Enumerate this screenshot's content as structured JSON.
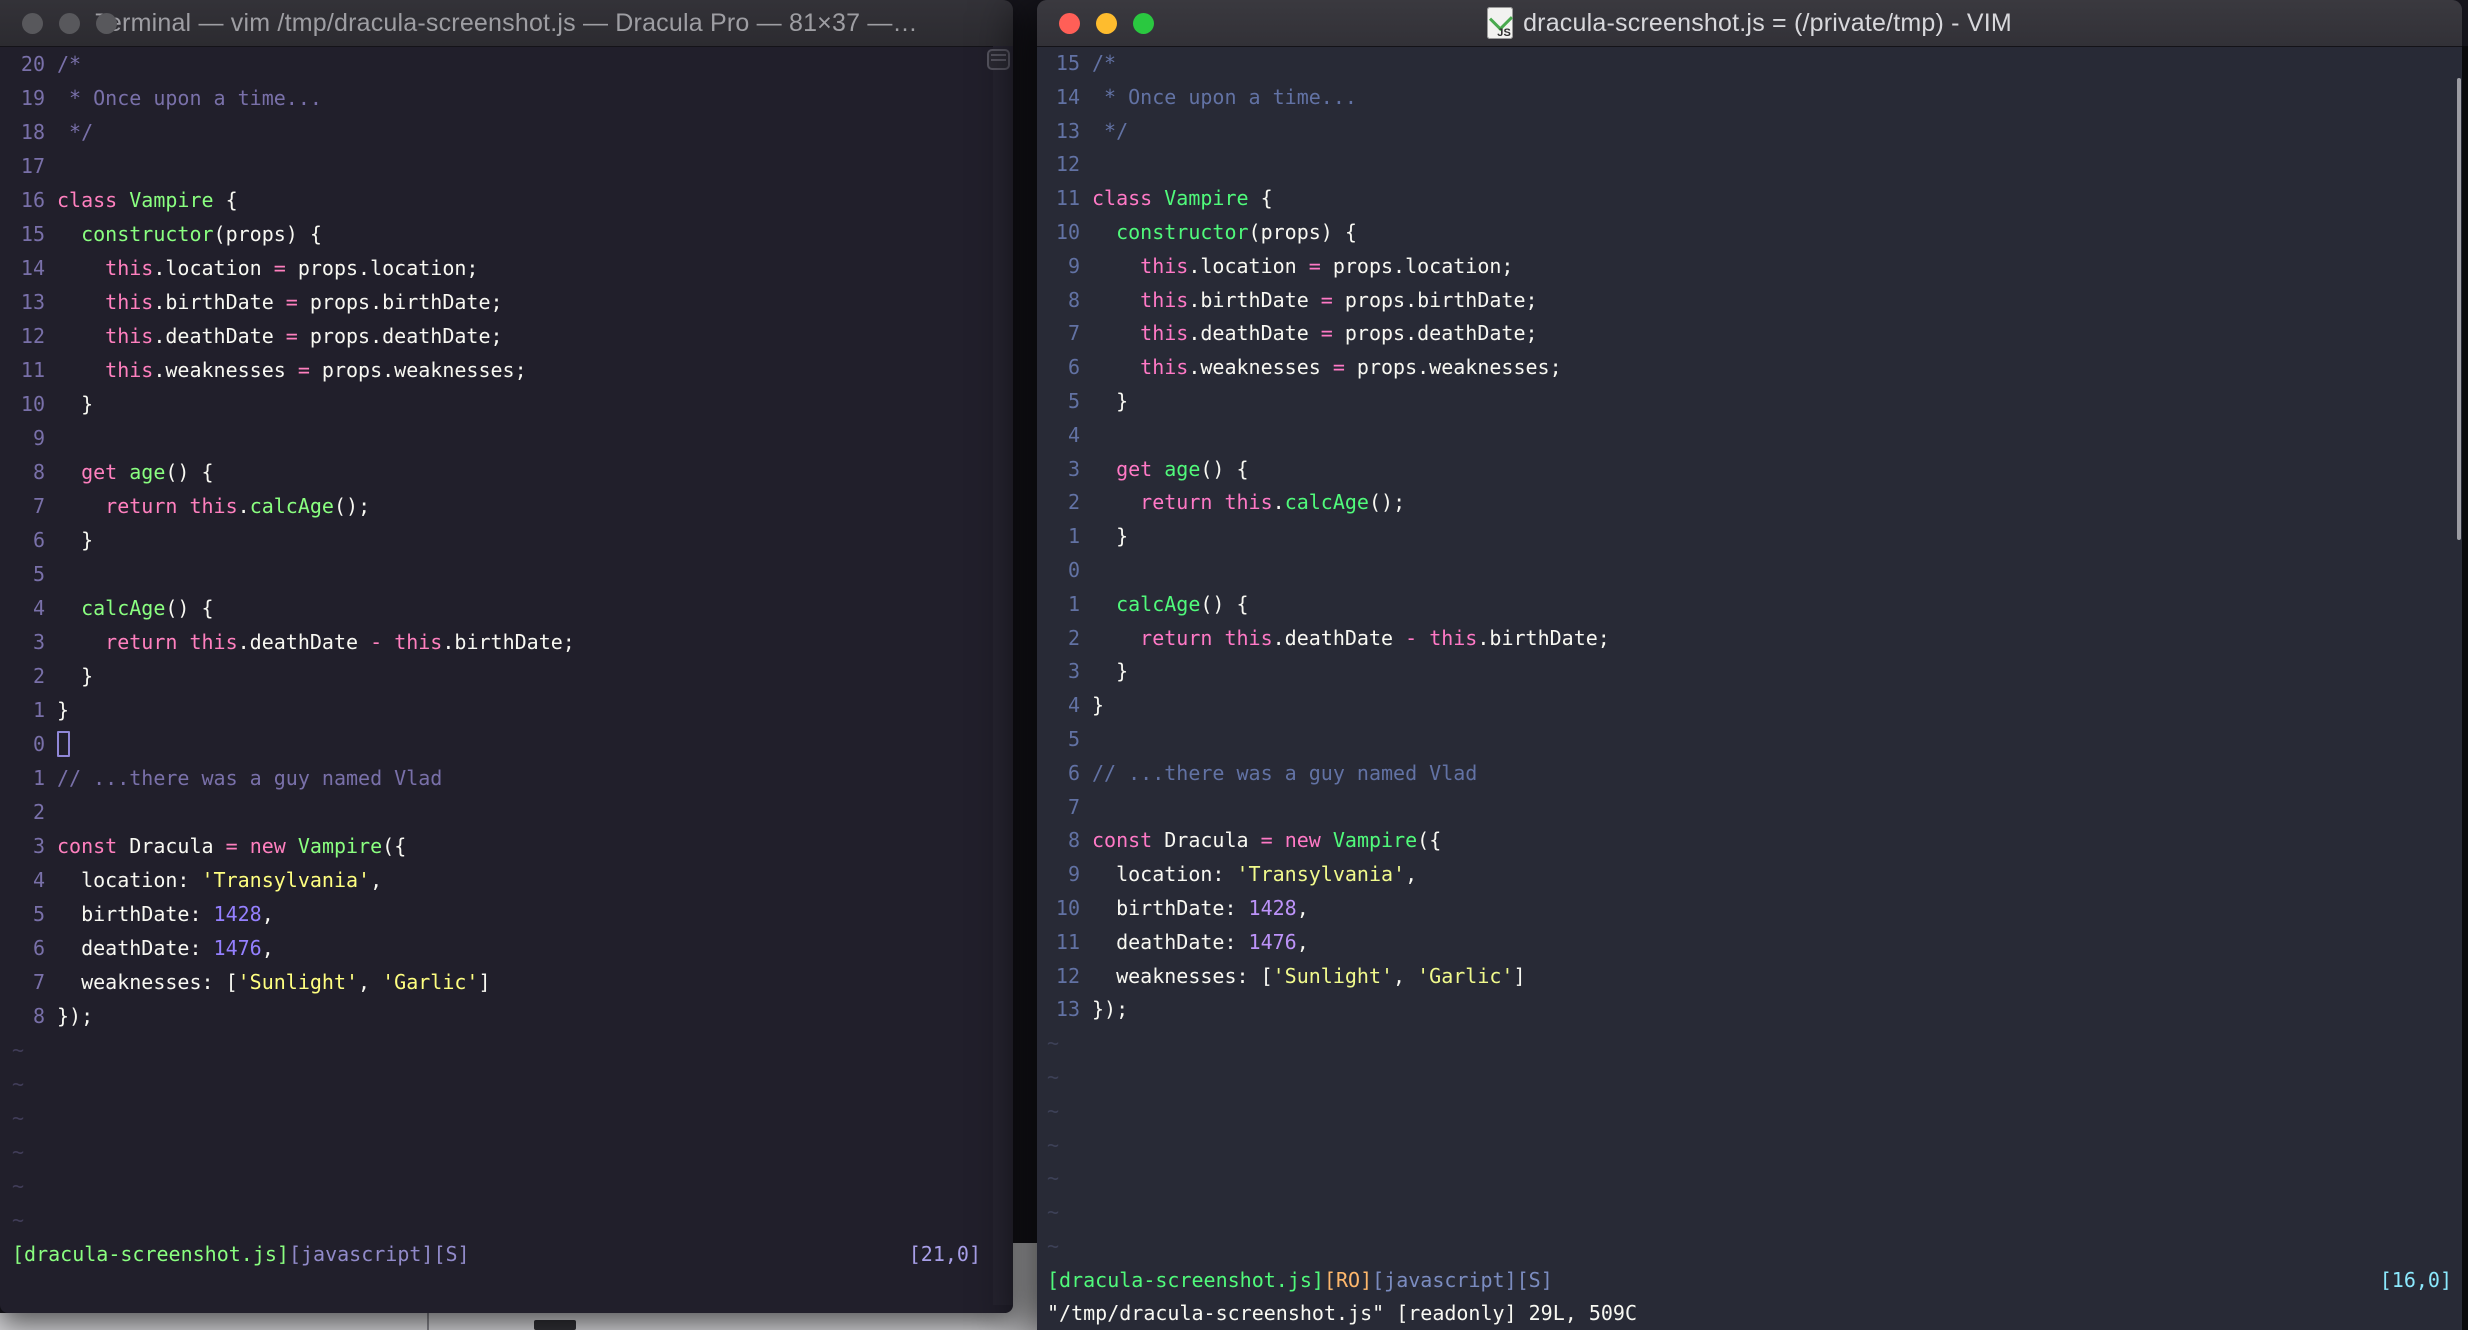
{
  "colors": {
    "desktop_strip": "#D1D1D4",
    "left_bg": "#211F2B",
    "right_bg": "#282A36",
    "left_titlebar": "#333238",
    "right_titlebar": "#3A393F",
    "left_title_text": "#9E9EA3",
    "right_title_text": "#D8D8DC",
    "light_inactive": "#58585C",
    "light_red": "#FF5F57",
    "light_yellow": "#FEBC2E",
    "light_green": "#2AC840"
  },
  "palettes": {
    "left": {
      "f": "#F8F8F2",
      "c": "#7970A9",
      "p": "#FF80BF",
      "g": "#8AFF80",
      "u": "#9580FF",
      "y": "#FFFF80",
      "o": "#FFCA80",
      "s": "#918AC9",
      "loc": "#A89FE8",
      "ln": "#7970A9",
      "tilde": "#413D59",
      "cursor": "#9087D8"
    },
    "right": {
      "f": "#F8F8F2",
      "c": "#6272A4",
      "p": "#FF79C6",
      "g": "#50FA7B",
      "u": "#BD93F9",
      "y": "#F1FA8C",
      "o": "#FFB86C",
      "s": "#7B8CC0",
      "loc": "#8BE9FD",
      "ln": "#6272A4",
      "tilde": "#3D4157",
      "cursor": "#F8F8F2"
    }
  },
  "left_window": {
    "title": "Terminal — vim /tmp/dracula-screenshot.js — Dracula Pro — 81×37 —…",
    "tilde_rows": 6,
    "status_left": [
      [
        "g",
        "[dracula-screenshot.js]"
      ],
      [
        "s",
        "[javascript][S]"
      ]
    ],
    "status_right": [
      [
        "loc",
        "[21,0]"
      ]
    ],
    "cmd": [],
    "lines": [
      {
        "n": "20",
        "seg": [
          [
            "c",
            "/*"
          ]
        ]
      },
      {
        "n": "19",
        "seg": [
          [
            "c",
            " * Once upon a time..."
          ]
        ]
      },
      {
        "n": "18",
        "seg": [
          [
            "c",
            " */"
          ]
        ]
      },
      {
        "n": "17",
        "seg": []
      },
      {
        "n": "16",
        "seg": [
          [
            "p",
            "class"
          ],
          [
            "f",
            " "
          ],
          [
            "g",
            "Vampire"
          ],
          [
            "f",
            " {"
          ]
        ]
      },
      {
        "n": "15",
        "seg": [
          [
            "f",
            "  "
          ],
          [
            "g",
            "constructor"
          ],
          [
            "f",
            "(props) {"
          ]
        ]
      },
      {
        "n": "14",
        "seg": [
          [
            "f",
            "    "
          ],
          [
            "p",
            "this"
          ],
          [
            "f",
            ".location "
          ],
          [
            "p",
            "="
          ],
          [
            "f",
            " props.location;"
          ]
        ]
      },
      {
        "n": "13",
        "seg": [
          [
            "f",
            "    "
          ],
          [
            "p",
            "this"
          ],
          [
            "f",
            ".birthDate "
          ],
          [
            "p",
            "="
          ],
          [
            "f",
            " props.birthDate;"
          ]
        ]
      },
      {
        "n": "12",
        "seg": [
          [
            "f",
            "    "
          ],
          [
            "p",
            "this"
          ],
          [
            "f",
            ".deathDate "
          ],
          [
            "p",
            "="
          ],
          [
            "f",
            " props.deathDate;"
          ]
        ]
      },
      {
        "n": "11",
        "seg": [
          [
            "f",
            "    "
          ],
          [
            "p",
            "this"
          ],
          [
            "f",
            ".weaknesses "
          ],
          [
            "p",
            "="
          ],
          [
            "f",
            " props.weaknesses;"
          ]
        ]
      },
      {
        "n": "10",
        "seg": [
          [
            "f",
            "  }"
          ]
        ]
      },
      {
        "n": "9",
        "seg": []
      },
      {
        "n": "8",
        "seg": [
          [
            "f",
            "  "
          ],
          [
            "p",
            "get"
          ],
          [
            "f",
            " "
          ],
          [
            "g",
            "age"
          ],
          [
            "f",
            "() {"
          ]
        ]
      },
      {
        "n": "7",
        "seg": [
          [
            "f",
            "    "
          ],
          [
            "p",
            "return"
          ],
          [
            "f",
            " "
          ],
          [
            "p",
            "this"
          ],
          [
            "f",
            "."
          ],
          [
            "g",
            "calcAge"
          ],
          [
            "f",
            "();"
          ]
        ]
      },
      {
        "n": "6",
        "seg": [
          [
            "f",
            "  }"
          ]
        ]
      },
      {
        "n": "5",
        "seg": []
      },
      {
        "n": "4",
        "seg": [
          [
            "f",
            "  "
          ],
          [
            "g",
            "calcAge"
          ],
          [
            "f",
            "() {"
          ]
        ]
      },
      {
        "n": "3",
        "seg": [
          [
            "f",
            "    "
          ],
          [
            "p",
            "return"
          ],
          [
            "f",
            " "
          ],
          [
            "p",
            "this"
          ],
          [
            "f",
            ".deathDate "
          ],
          [
            "p",
            "-"
          ],
          [
            "f",
            " "
          ],
          [
            "p",
            "this"
          ],
          [
            "f",
            ".birthDate;"
          ]
        ]
      },
      {
        "n": "2",
        "seg": [
          [
            "f",
            "  }"
          ]
        ]
      },
      {
        "n": "1",
        "seg": [
          [
            "f",
            "}"
          ]
        ]
      },
      {
        "n": "0",
        "seg": [],
        "cursor": "hollow"
      },
      {
        "n": "1",
        "seg": [
          [
            "c",
            "// ...there was a guy named Vlad"
          ]
        ]
      },
      {
        "n": "2",
        "seg": []
      },
      {
        "n": "3",
        "seg": [
          [
            "p",
            "const"
          ],
          [
            "f",
            " Dracula "
          ],
          [
            "p",
            "="
          ],
          [
            "f",
            " "
          ],
          [
            "p",
            "new"
          ],
          [
            "f",
            " "
          ],
          [
            "g",
            "Vampire"
          ],
          [
            "f",
            "({"
          ]
        ]
      },
      {
        "n": "4",
        "seg": [
          [
            "f",
            "  location: "
          ],
          [
            "y",
            "'Transylvania'"
          ],
          [
            "f",
            ","
          ]
        ]
      },
      {
        "n": "5",
        "seg": [
          [
            "f",
            "  birthDate: "
          ],
          [
            "u",
            "1428"
          ],
          [
            "f",
            ","
          ]
        ]
      },
      {
        "n": "6",
        "seg": [
          [
            "f",
            "  deathDate: "
          ],
          [
            "u",
            "1476"
          ],
          [
            "f",
            ","
          ]
        ]
      },
      {
        "n": "7",
        "seg": [
          [
            "f",
            "  weaknesses: ["
          ],
          [
            "y",
            "'Sunlight'"
          ],
          [
            "f",
            ", "
          ],
          [
            "y",
            "'Garlic'"
          ],
          [
            "f",
            "]"
          ]
        ]
      },
      {
        "n": "8",
        "seg": [
          [
            "f",
            "});"
          ]
        ]
      }
    ]
  },
  "right_window": {
    "title": "dracula-screenshot.js = (/private/tmp) - VIM",
    "tilde_rows": 7,
    "status_left": [
      [
        "g",
        "[dracula-screenshot.js]"
      ],
      [
        "o",
        "[RO]"
      ],
      [
        "s",
        "[javascript][S]"
      ]
    ],
    "status_right": [
      [
        "loc",
        "[16,0]"
      ]
    ],
    "cmd": [
      [
        "f",
        "\"/tmp/dracula-screenshot.js\" [readonly] 29L, 509C"
      ]
    ],
    "lines": [
      {
        "n": "15",
        "seg": [
          [
            "c",
            "/*"
          ]
        ]
      },
      {
        "n": "14",
        "seg": [
          [
            "c",
            " * Once upon a time..."
          ]
        ]
      },
      {
        "n": "13",
        "seg": [
          [
            "c",
            " */"
          ]
        ]
      },
      {
        "n": "12",
        "seg": []
      },
      {
        "n": "11",
        "seg": [
          [
            "p",
            "class"
          ],
          [
            "f",
            " "
          ],
          [
            "g",
            "Vampire"
          ],
          [
            "f",
            " {"
          ]
        ]
      },
      {
        "n": "10",
        "seg": [
          [
            "f",
            "  "
          ],
          [
            "g",
            "constructor"
          ],
          [
            "f",
            "(props) {"
          ]
        ]
      },
      {
        "n": "9",
        "seg": [
          [
            "f",
            "    "
          ],
          [
            "p",
            "this"
          ],
          [
            "f",
            ".location "
          ],
          [
            "p",
            "="
          ],
          [
            "f",
            " props.location;"
          ]
        ]
      },
      {
        "n": "8",
        "seg": [
          [
            "f",
            "    "
          ],
          [
            "p",
            "this"
          ],
          [
            "f",
            ".birthDate "
          ],
          [
            "p",
            "="
          ],
          [
            "f",
            " props.birthDate;"
          ]
        ]
      },
      {
        "n": "7",
        "seg": [
          [
            "f",
            "    "
          ],
          [
            "p",
            "this"
          ],
          [
            "f",
            ".deathDate "
          ],
          [
            "p",
            "="
          ],
          [
            "f",
            " props.deathDate;"
          ]
        ]
      },
      {
        "n": "6",
        "seg": [
          [
            "f",
            "    "
          ],
          [
            "p",
            "this"
          ],
          [
            "f",
            ".weaknesses "
          ],
          [
            "p",
            "="
          ],
          [
            "f",
            " props.weaknesses;"
          ]
        ]
      },
      {
        "n": "5",
        "seg": [
          [
            "f",
            "  }"
          ]
        ]
      },
      {
        "n": "4",
        "seg": []
      },
      {
        "n": "3",
        "seg": [
          [
            "f",
            "  "
          ],
          [
            "p",
            "get"
          ],
          [
            "f",
            " "
          ],
          [
            "g",
            "age"
          ],
          [
            "f",
            "() {"
          ]
        ]
      },
      {
        "n": "2",
        "seg": [
          [
            "f",
            "    "
          ],
          [
            "p",
            "return"
          ],
          [
            "f",
            " "
          ],
          [
            "p",
            "this"
          ],
          [
            "f",
            "."
          ],
          [
            "g",
            "calcAge"
          ],
          [
            "f",
            "();"
          ]
        ]
      },
      {
        "n": "1",
        "seg": [
          [
            "f",
            "  }"
          ]
        ]
      },
      {
        "n": "0",
        "seg": []
      },
      {
        "n": "1",
        "seg": [
          [
            "f",
            "  "
          ],
          [
            "g",
            "calcAge"
          ],
          [
            "f",
            "() {"
          ]
        ]
      },
      {
        "n": "2",
        "seg": [
          [
            "f",
            "    "
          ],
          [
            "p",
            "return"
          ],
          [
            "f",
            " "
          ],
          [
            "p",
            "this"
          ],
          [
            "f",
            ".deathDate "
          ],
          [
            "p",
            "-"
          ],
          [
            "f",
            " "
          ],
          [
            "p",
            "this"
          ],
          [
            "f",
            ".birthDate;"
          ]
        ]
      },
      {
        "n": "3",
        "seg": [
          [
            "f",
            "  }"
          ]
        ]
      },
      {
        "n": "4",
        "seg": [
          [
            "f",
            "}"
          ]
        ]
      },
      {
        "n": "5",
        "seg": []
      },
      {
        "n": "6",
        "seg": [
          [
            "c",
            "// ...there was a guy named Vlad"
          ]
        ]
      },
      {
        "n": "7",
        "seg": []
      },
      {
        "n": "8",
        "seg": [
          [
            "p",
            "const"
          ],
          [
            "f",
            " Dracula "
          ],
          [
            "p",
            "="
          ],
          [
            "f",
            " "
          ],
          [
            "p",
            "new"
          ],
          [
            "f",
            " "
          ],
          [
            "g",
            "Vampire"
          ],
          [
            "f",
            "({"
          ]
        ]
      },
      {
        "n": "9",
        "seg": [
          [
            "f",
            "  location: "
          ],
          [
            "y",
            "'Transylvania'"
          ],
          [
            "f",
            ","
          ]
        ]
      },
      {
        "n": "10",
        "seg": [
          [
            "f",
            "  birthDate: "
          ],
          [
            "u",
            "1428"
          ],
          [
            "f",
            ","
          ]
        ]
      },
      {
        "n": "11",
        "seg": [
          [
            "f",
            "  deathDate: "
          ],
          [
            "u",
            "1476"
          ],
          [
            "f",
            ","
          ]
        ]
      },
      {
        "n": "12",
        "seg": [
          [
            "f",
            "  weaknesses: ["
          ],
          [
            "y",
            "'Sunlight'"
          ],
          [
            "f",
            ", "
          ],
          [
            "y",
            "'Garlic'"
          ],
          [
            "f",
            "]"
          ]
        ]
      },
      {
        "n": "13",
        "seg": [
          [
            "f",
            "});"
          ]
        ]
      }
    ]
  }
}
